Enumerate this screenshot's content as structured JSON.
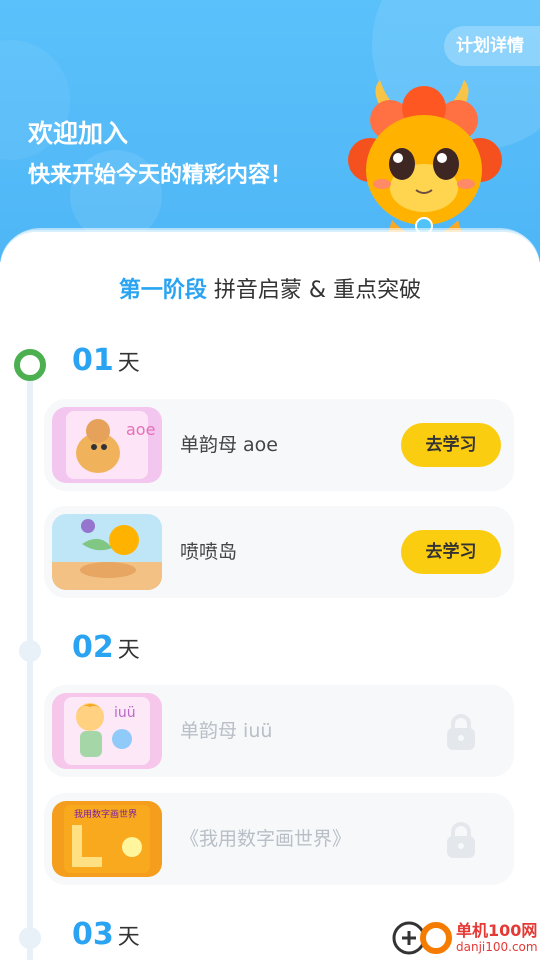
{
  "header": {
    "plan_detail_label": "计划详情",
    "welcome_title": "欢迎加入",
    "welcome_subtitle": "快来开始今天的精彩内容！"
  },
  "stage": {
    "highlight": "第一阶段",
    "title": "拼音启蒙 & 重点突破"
  },
  "days": [
    {
      "num": "01",
      "unit": "天",
      "lessons": [
        {
          "title": "单韵母 aoe",
          "action": "去学习",
          "locked": false,
          "thumb_text": "aoe"
        },
        {
          "title": "喷喷岛",
          "action": "去学习",
          "locked": false
        }
      ]
    },
    {
      "num": "02",
      "unit": "天",
      "lessons": [
        {
          "title": "单韵母 iuü",
          "locked": true,
          "thumb_text": "iuü"
        },
        {
          "title": "《我用数字画世界》",
          "locked": true,
          "thumb_text": "我用数字画世界"
        }
      ]
    },
    {
      "num": "03",
      "unit": "天",
      "lessons": []
    }
  ],
  "watermark": {
    "brand": "单机100网",
    "url": "danji100.com"
  },
  "colors": {
    "header_blue": "#4fb6f6",
    "accent_blue": "#2aa4f2",
    "study_button": "#fbcd11",
    "active_dot": "#4caf50"
  }
}
